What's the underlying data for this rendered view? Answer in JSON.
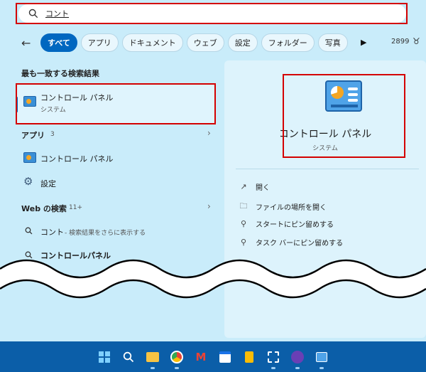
{
  "search": {
    "query": "コント"
  },
  "tabs": [
    "すべて",
    "アプリ",
    "ドキュメント",
    "ウェブ",
    "設定",
    "フォルダー",
    "写真"
  ],
  "points": "2899",
  "best_match": {
    "heading": "最も一致する検索結果",
    "title": "コントロール パネル",
    "subtitle": "システム"
  },
  "apps": {
    "heading": "アプリ",
    "count": "3",
    "items": [
      "コントロール パネル",
      "設定"
    ]
  },
  "web": {
    "heading": "Web の検索",
    "count": "11+",
    "items": [
      {
        "query": "コント",
        "hint": " - 検索結果をさらに表示する"
      },
      {
        "query": "コントロールパネル",
        "hint": ""
      }
    ]
  },
  "detail": {
    "title": "コントロール パネル",
    "subtitle": "システム",
    "actions": [
      "開く",
      "ファイルの場所を開く",
      "スタートにピン留めする",
      "タスク バーにピン留めする"
    ]
  },
  "icons": {
    "taskbar": [
      "windows-start-icon",
      "search-icon",
      "file-explorer-icon",
      "chrome-icon",
      "gmail-icon",
      "calendar-icon",
      "keep-icon",
      "snipping-tool-icon",
      "app-icon",
      "control-panel-icon"
    ]
  },
  "colors": {
    "accent": "#0067c0",
    "highlight": "#d40000",
    "taskbar": "#0b5ea8"
  }
}
